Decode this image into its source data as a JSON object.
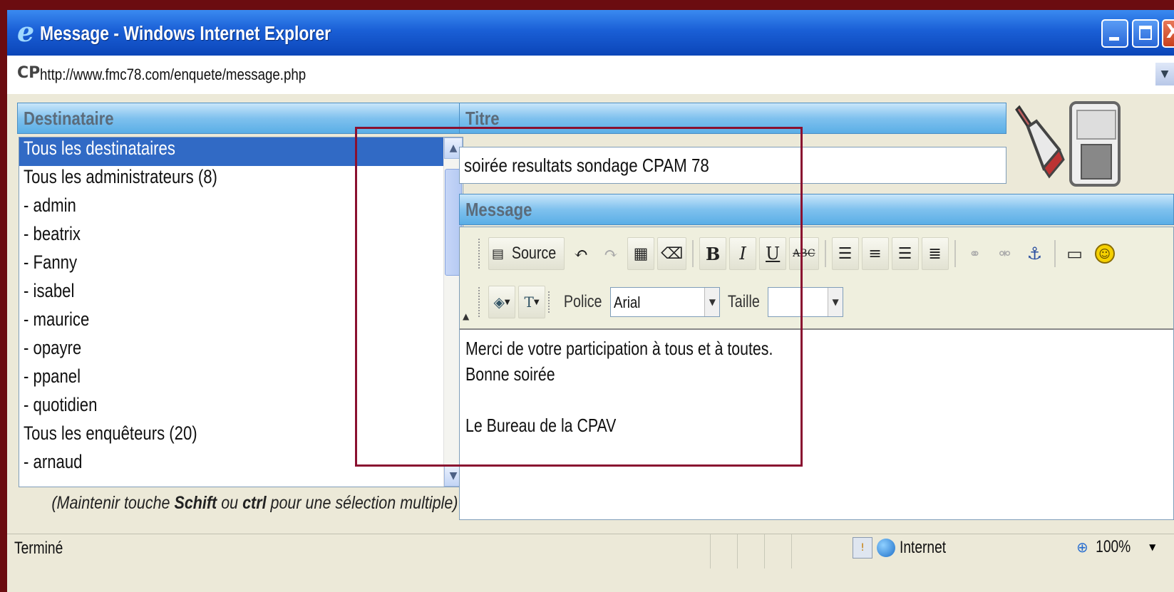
{
  "window": {
    "title": "Message - Windows Internet Explorer",
    "icon": "ie-icon",
    "close_glyph": "X"
  },
  "address": {
    "url": "http://www.fmc78.com/enquete/message.php",
    "site_icon_text": "CP"
  },
  "recipients": {
    "header": "Destinataire",
    "items": [
      {
        "label": "Tous les destinataires",
        "selected": true
      },
      {
        "label": "Tous les administrateurs (8)",
        "selected": false
      },
      {
        "label": "- admin",
        "selected": false
      },
      {
        "label": "- beatrix",
        "selected": false
      },
      {
        "label": "- Fanny",
        "selected": false
      },
      {
        "label": "- isabel",
        "selected": false
      },
      {
        "label": "- maurice",
        "selected": false
      },
      {
        "label": "- opayre",
        "selected": false
      },
      {
        "label": "- ppanel",
        "selected": false
      },
      {
        "label": "- quotidien",
        "selected": false
      },
      {
        "label": "Tous les enquêteurs (20)",
        "selected": false
      },
      {
        "label": "- arnaud",
        "selected": false
      }
    ],
    "hint_prefix": "(Maintenir touche ",
    "hint_key1": "Schift",
    "hint_mid": " ou ",
    "hint_key2": "ctrl",
    "hint_suffix": " pour une sélection multiple)"
  },
  "titre": {
    "header": "Titre",
    "value": "soirée resultats sondage CPAM 78"
  },
  "message": {
    "header": "Message",
    "toolbar": {
      "source_label": "Source",
      "font_label": "Police",
      "font_value": "Arial",
      "size_label": "Taille",
      "size_value": ""
    },
    "body_lines": [
      "Merci de votre participation à tous et à toutes.",
      "Bonne soirée",
      "",
      "Le Bureau de la CPAV"
    ]
  },
  "status": {
    "text": "Terminé",
    "zone": "Internet",
    "zoom": "100%"
  },
  "colors": {
    "selection": "#316ac5",
    "highlight_frame": "#8a1030",
    "titlebar": "#1a5fd6"
  }
}
